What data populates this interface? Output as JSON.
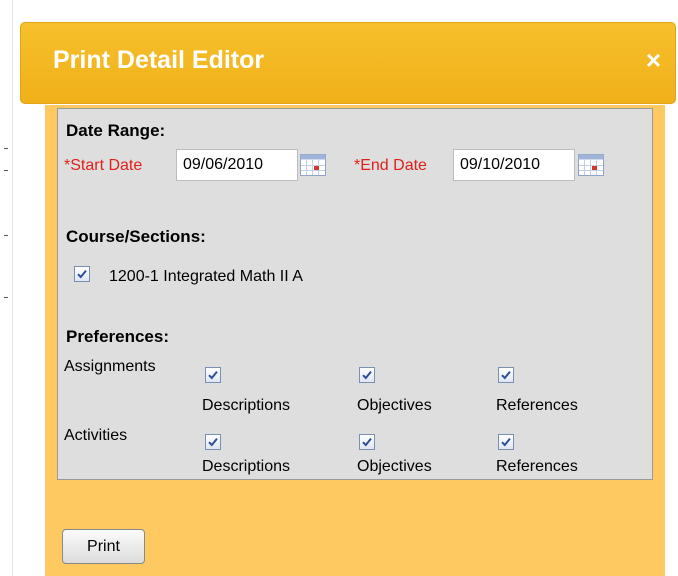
{
  "dialog": {
    "title": "Print Detail Editor",
    "close_label": "×",
    "date_range": {
      "heading": "Date Range:",
      "start_label": "*Start Date",
      "start_value": "09/06/2010",
      "end_label": "*End Date",
      "end_value": "09/10/2010"
    },
    "courses": {
      "heading": "Course/Sections:",
      "items": [
        {
          "label": "1200-1 Integrated Math II A",
          "checked": true
        }
      ]
    },
    "preferences": {
      "heading": "Preferences:",
      "rows": [
        {
          "label": "Assignments",
          "options": [
            {
              "label": "Descriptions",
              "checked": true
            },
            {
              "label": "Objectives",
              "checked": true
            },
            {
              "label": "References",
              "checked": true
            }
          ]
        },
        {
          "label": "Activities",
          "options": [
            {
              "label": "Descriptions",
              "checked": true
            },
            {
              "label": "Objectives",
              "checked": true
            },
            {
              "label": "References",
              "checked": true
            }
          ]
        }
      ]
    },
    "print_label": "Print"
  },
  "colors": {
    "titlebar": "#f2b41f",
    "panel": "#fdc960",
    "form_bg": "#dedede",
    "required_label": "#e0201a",
    "checkmark": "#2e4f98"
  }
}
